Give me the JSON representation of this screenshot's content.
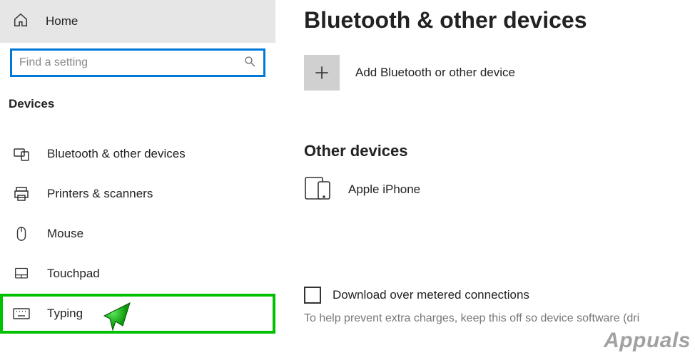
{
  "sidebar": {
    "home_label": "Home",
    "search_placeholder": "Find a setting",
    "section_title": "Devices",
    "items": [
      {
        "label": "Bluetooth & other devices"
      },
      {
        "label": "Printers & scanners"
      },
      {
        "label": "Mouse"
      },
      {
        "label": "Touchpad"
      },
      {
        "label": "Typing"
      }
    ]
  },
  "main": {
    "title": "Bluetooth & other devices",
    "add_label": "Add Bluetooth or other device",
    "other_heading": "Other devices",
    "device_name": "Apple iPhone",
    "checkbox_label": "Download over metered connections",
    "hint": "To help prevent extra charges, keep this off so device software (dri"
  },
  "watermark": "Appuals"
}
